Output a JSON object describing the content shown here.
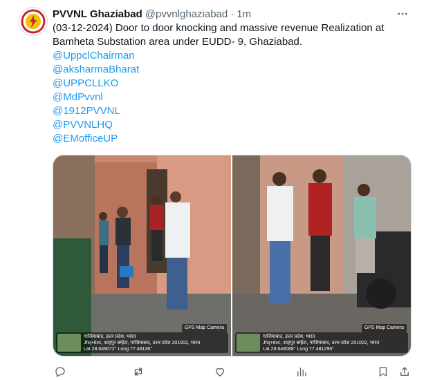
{
  "tweet": {
    "author_name": "PVVNL Ghaziabad",
    "author_handle": "@pvvnlghaziabad",
    "separator": "·",
    "time": "1m",
    "text_lines": [
      "(03-12-2024) Door to door knocking and massive revenue Realization at",
      "Bamheta Substation area under EUDD- 9, Ghaziabad."
    ],
    "mentions": [
      "@UppclChairman",
      "@aksharmaBharat",
      "@UPPCLLKO",
      "@MdPvvnl",
      "@1912PVVNL",
      "@PVVNLHQ",
      "@EMofficeUP"
    ]
  },
  "photos": [
    {
      "gps_badge": "GPS Map Camera",
      "gps_lines": [
        "गाजियाबाद, उत्तर प्रदेश, भारत",
        "Jfxj+6vc, शाहपुर बम्हैटा, गाजियाबाद, उत्तर प्रदेश 201002, भारत",
        "Lat 28.648072° Long 77.48136°"
      ]
    },
    {
      "gps_badge": "GPS Map Camera",
      "gps_lines": [
        "गाजियाबाद, उत्तर प्रदेश, भारत",
        "Jfxj+6vc, शाहपुर बम्हैटा, गाजियाबाद, उत्तर प्रदेश 201002, भारत",
        "Lat 28.648088° Long 77.481296°"
      ]
    }
  ],
  "icons": {
    "more": "more-options-icon",
    "reply": "reply-icon",
    "retweet": "retweet-icon",
    "like": "like-icon",
    "views": "views-icon",
    "bookmark": "bookmark-icon",
    "share": "share-icon"
  },
  "colors": {
    "link": "#1d9bf0",
    "text": "#0f1419",
    "secondary": "#536471"
  }
}
